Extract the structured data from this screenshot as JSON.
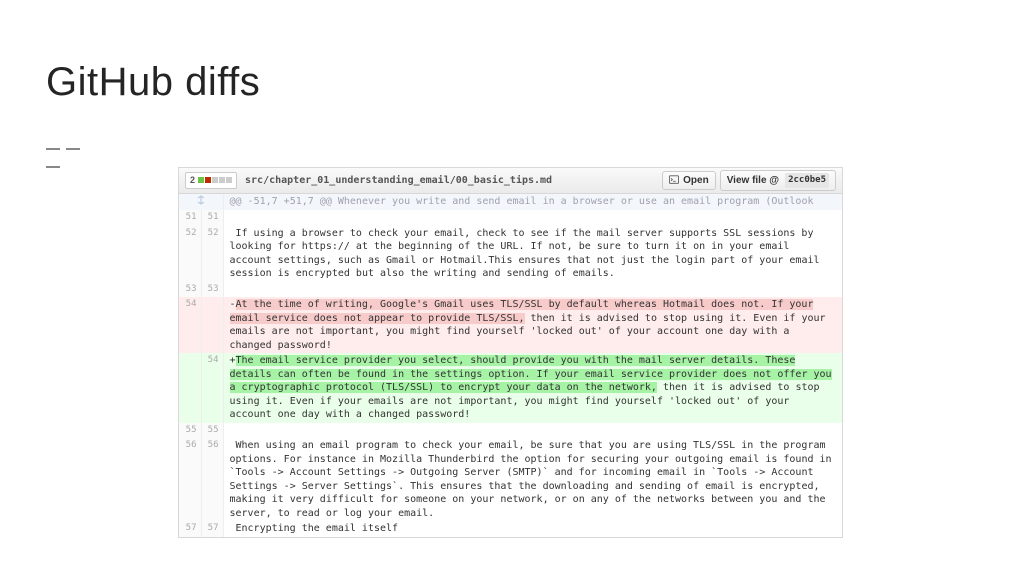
{
  "slide": {
    "title": "GitHub diffs"
  },
  "diff": {
    "changes_count": "2",
    "file_path": "src/chapter_01_understanding_email/00_basic_tips.md",
    "open_label": "Open",
    "view_file_label": "View file @",
    "sha": "2cc0be5",
    "hunk_header": "@@ -51,7 +51,7 @@ Whenever you write and send email in a browser or use an email program (Outlook",
    "rows": [
      {
        "type": "hunk"
      },
      {
        "type": "ctx",
        "old": "51",
        "new": "51",
        "text": ""
      },
      {
        "type": "ctx",
        "old": "52",
        "new": "52",
        "text": "If using a browser to check your email, check to see if the mail server supports SSL sessions by looking for https:// at the beginning of the URL. If not, be sure to turn it on in your email account settings, such as Gmail or Hotmail.This ensures that not just the login part of your email session is encrypted but also the writing and sending of emails."
      },
      {
        "type": "ctx",
        "old": "53",
        "new": "53",
        "text": ""
      },
      {
        "type": "del",
        "old": "54",
        "new": "",
        "hl": "At the time of writing, Google's Gmail uses TLS/SSL by default whereas Hotmail does not. If your email service does not appear to provide TLS/SSL,",
        "rest": " then it is advised to stop using it. Even if your emails are not important, you might find yourself 'locked out' of your account one day with a changed password!"
      },
      {
        "type": "add",
        "old": "",
        "new": "54",
        "hl": "The email service provider you select, should provide you with the mail server details. These details can often be found in the settings option. If your email service provider does not offer you a cryptographic protocol (TLS/SSL) to encrypt your data on the network,",
        "rest": " then it is advised to stop using it. Even if your emails are not important, you might find yourself 'locked out' of your account one day with a changed password!"
      },
      {
        "type": "ctx",
        "old": "55",
        "new": "55",
        "text": ""
      },
      {
        "type": "ctx",
        "old": "56",
        "new": "56",
        "text": "When using an email program to check your email, be sure that you are using TLS/SSL in the program options. For instance in Mozilla Thunderbird the option for securing your outgoing email is found in `Tools -> Account Settings -> Outgoing Server (SMTP)` and for incoming email in `Tools -> Account Settings -> Server Settings`. This ensures that the downloading and sending of email is encrypted, making it very difficult for someone on your network, or on any of the networks between you and the server, to read or log your email."
      },
      {
        "type": "ctx",
        "old": "57",
        "new": "57",
        "text": "Encrypting the email itself"
      }
    ]
  }
}
